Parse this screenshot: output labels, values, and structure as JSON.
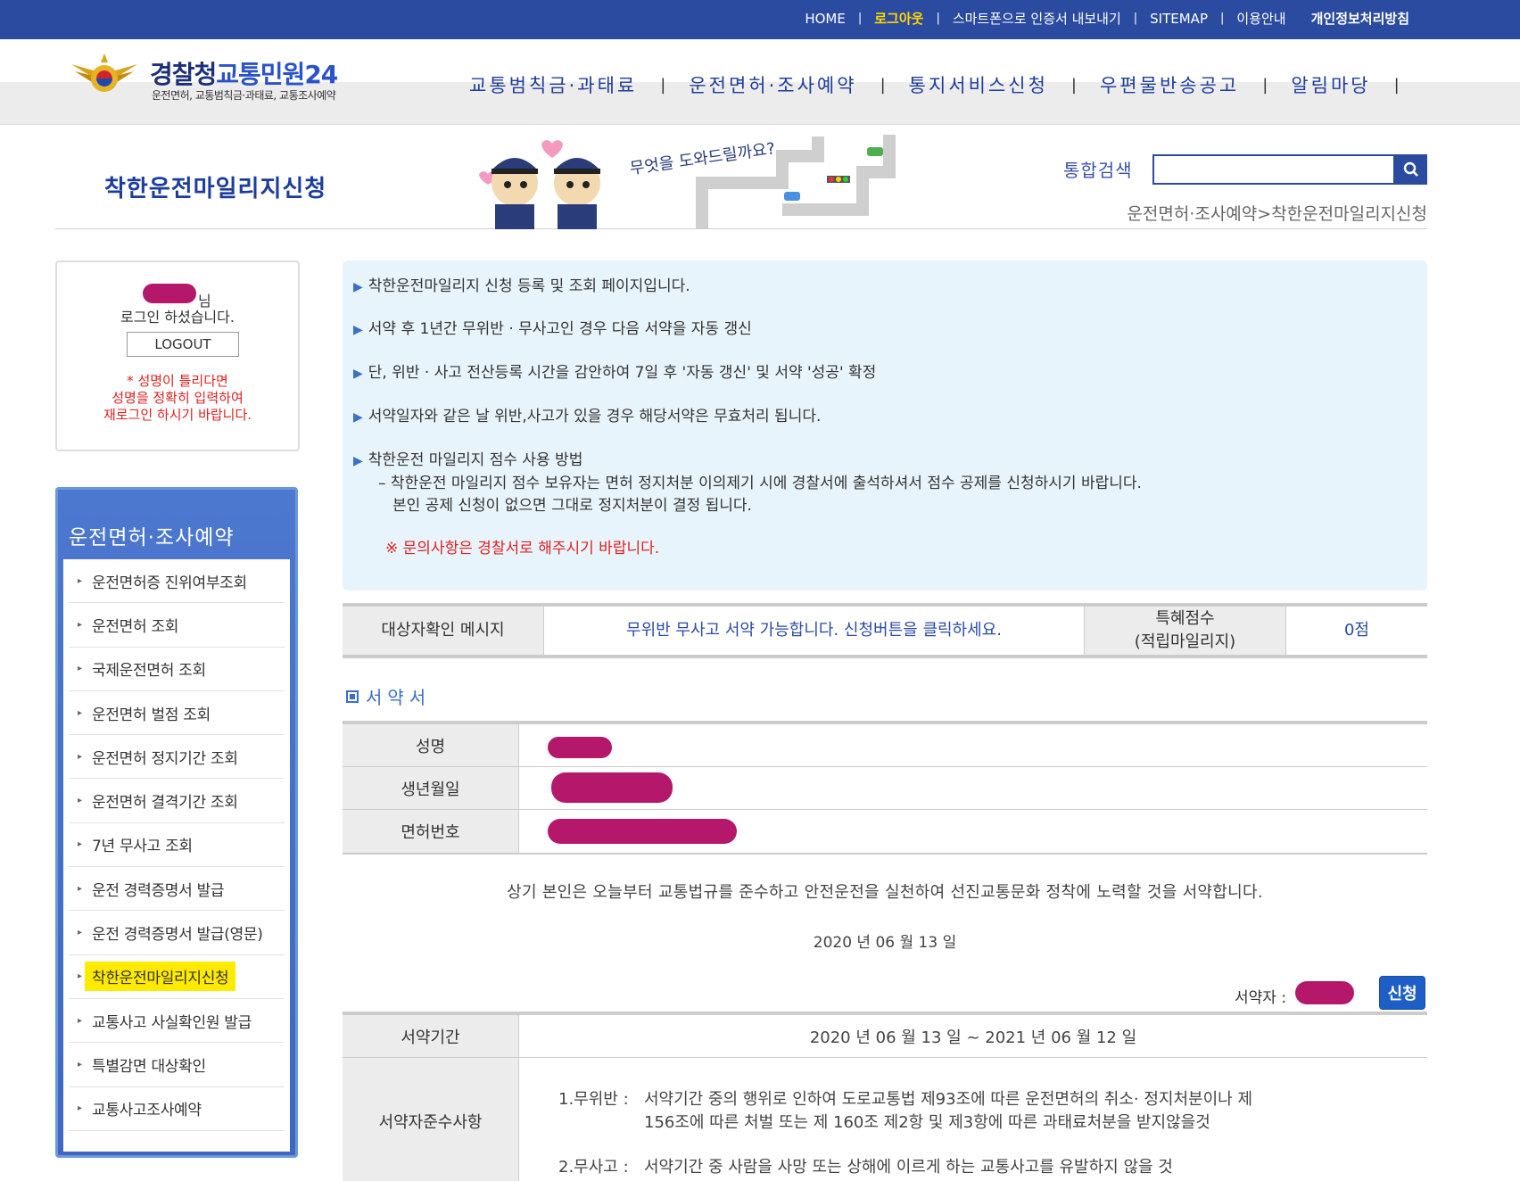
{
  "topbar": {
    "links": [
      "HOME",
      "로그아웃",
      "스마트폰으로 인증서 내보내기",
      "SITEMAP",
      "이용안내",
      "개인정보처리방침"
    ]
  },
  "logo": {
    "title_a": "경찰청",
    "title_b": "교통민원24",
    "subtitle": "운전면허, 교통범칙금·과태료, 교통조사예약"
  },
  "gnb": [
    "교통범칙금·과태료",
    "운전면허·조사예약",
    "통지서비스신청",
    "우편물반송공고",
    "알림마당"
  ],
  "page": {
    "title": "착한운전마일리지신청",
    "mascot_text": "무엇을 도와드릴까요?",
    "search_label": "통합검색",
    "search_value": "",
    "breadcrumb": "운전면허·조사예약>착한운전마일리지신청"
  },
  "login": {
    "suffix": "님",
    "message": "로그인 하셨습니다.",
    "logout_label": "LOGOUT",
    "warning_1": "* 성명이 틀리다면",
    "warning_2": "성명을 정확히 입력하여",
    "warning_3": "재로그인 하시기 바랍니다."
  },
  "lnb": {
    "title": "운전면허·조사예약",
    "items": [
      "운전면허증 진위여부조회",
      "운전면허 조회",
      "국제운전면허 조회",
      "운전면허 벌점 조회",
      "운전면허 정지기간 조회",
      "운전면허 결격기간 조회",
      "7년 무사고 조회",
      "운전 경력증명서 발급",
      "운전 경력증명서 발급(영문)",
      "착한운전마일리지신청",
      "교통사고 사실확인원 발급",
      "특별감면 대상확인",
      "교통사고조사예약"
    ]
  },
  "info": {
    "line1": "착한운전마일리지 신청 등록 및 조회 페이지입니다.",
    "line2": "서약 후 1년간 무위반 · 무사고인 경우 다음 서약을 자동 갱신",
    "line3": "단, 위반 · 사고 전산등록 시간을 감안하여 7일 후 '자동 갱신' 및 서약 '성공' 확정",
    "line4": "서약일자와 같은 날 위반,사고가 있을 경우 해당서약은 무효처리 됩니다.",
    "line5": "착한운전 마일리지 점수 사용 방법",
    "line5_sub1": "– 착한운전 마일리지 점수 보유자는 면허 정지처분 이의제기 시에 경찰서에 출석하셔서 점수 공제를 신청하시기 바랍니다.",
    "line5_sub2": "본인 공제 신청이 없으면 그대로 정지처분이 결정 됩니다.",
    "note": "※ 문의사항은 경찰서로 해주시기 바랍니다."
  },
  "status": {
    "label": "대상자확인 메시지",
    "message": "무위반 무사고 서약 가능합니다. 신청버튼을 클릭하세요.",
    "points_label_1": "특혜점수",
    "points_label_2": "(적립마일리지)",
    "points_value": "0점"
  },
  "pledge": {
    "section_title": "서약서",
    "name_label": "성명",
    "birth_label": "생년월일",
    "license_label": "면허번호",
    "oath": "상기 본인은 오늘부터 교통법규를 준수하고 안전운전을 실천하여 선진교통문화 정착에 노력할 것을 서약합니다.",
    "date": "2020 년 06 월 13 일",
    "signer_label": "서약자 :",
    "apply_label": "신청"
  },
  "term": {
    "period_label": "서약기간",
    "period_value": "2020 년 06 월 13 일 ~ 2021 년 06 월 12 일",
    "rules_label": "서약자준수사항",
    "rule1_key": "1.무위반 :",
    "rule1_a": "서약기간 중의 행위로 인하여 도로교통법 제93조에 따른 운전면허의 취소· 정지처분이나 제",
    "rule1_b": "156조에 따른 처벌 또는 제 160조 제2항 및 제3항에 따른 과태료처분을 받지않을것",
    "rule2_key": "2.무사고 :",
    "rule2_a": "서약기간 중 사람을 사망 또는 상해에 이르게 하는 교통사고를 유발하지 않을 것"
  }
}
